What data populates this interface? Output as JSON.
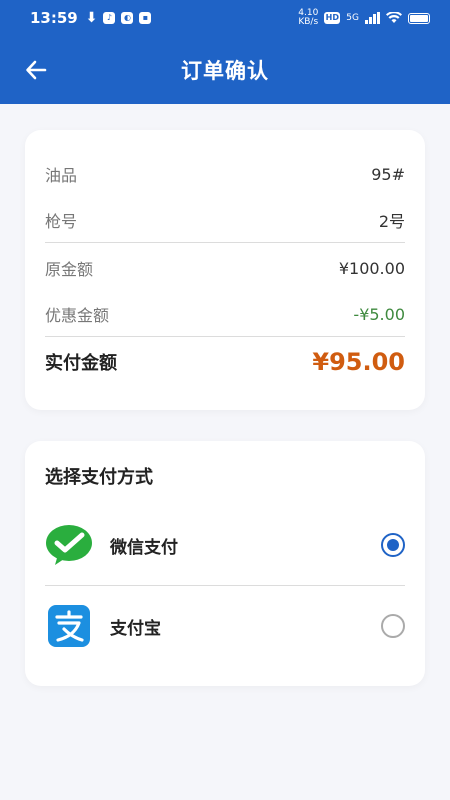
{
  "status_bar": {
    "time": "13:59",
    "net_speed": "4.10\nKB/s",
    "network": "5G"
  },
  "header": {
    "title": "订单确认"
  },
  "order": {
    "fuel_label": "油品",
    "fuel_value": "95#",
    "nozzle_label": "枪号",
    "nozzle_value": "2号",
    "original_label": "原金额",
    "original_value": "¥100.00",
    "discount_label": "优惠金额",
    "discount_value": "-¥5.00",
    "actual_label": "实付金额",
    "actual_value": "¥95.00"
  },
  "payment": {
    "title": "选择支付方式",
    "options": [
      {
        "label": "微信支付",
        "icon": "wechat-pay-icon",
        "selected": true
      },
      {
        "label": "支付宝",
        "icon": "alipay-icon",
        "selected": false
      }
    ]
  },
  "colors": {
    "primary": "#1f63c6",
    "total_amount": "#d05c10",
    "discount": "#3f8a3f",
    "wechat_green": "#2aae3e",
    "alipay_blue": "#1c8fe0"
  }
}
